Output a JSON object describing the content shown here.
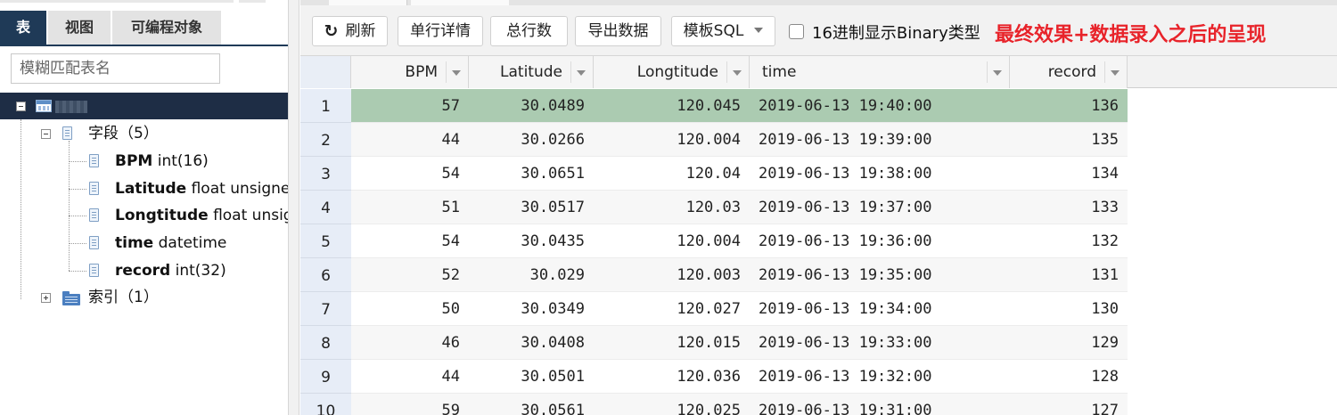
{
  "left_panel": {
    "tabs": [
      {
        "label": "表",
        "active": true
      },
      {
        "label": "视图",
        "active": false
      },
      {
        "label": "可编程对象",
        "active": false
      }
    ],
    "filter_placeholder": "模糊匹配表名",
    "tree": {
      "root_icon": "table-icon",
      "fields_group": {
        "label": "字段（5）",
        "icon": "document-icon"
      },
      "fields": [
        {
          "name": "BPM",
          "type": "int(16)"
        },
        {
          "name": "Latitude",
          "type": "float unsigned"
        },
        {
          "name": "Longtitude",
          "type": "float unsigned"
        },
        {
          "name": "time",
          "type": "datetime"
        },
        {
          "name": "record",
          "type": "int(32)"
        }
      ],
      "index_group": {
        "label": "索引（1）",
        "icon": "folder-index-icon"
      }
    }
  },
  "toolbar": {
    "refresh_icon": "refresh-icon",
    "refresh_label": "刷新",
    "row_detail_label": "单行详情",
    "total_rows_label": "总行数",
    "export_label": "导出数据",
    "template_sql_label": "模板SQL",
    "hex_checkbox_label": "16进制显示Binary类型",
    "hex_checked": false
  },
  "annotation": {
    "text": "最终效果+数据录入之后的呈现",
    "color": "#e8232a"
  },
  "grid": {
    "columns": [
      "BPM",
      "Latitude",
      "Longtitude",
      "time",
      "record"
    ],
    "selected_row": 1,
    "selected_color": "#abcbb1",
    "rows": [
      {
        "n": "1",
        "bpm": "57",
        "lat": "30.0489",
        "lng": "120.045",
        "time": "2019-06-13 19:40:00",
        "rec": "136"
      },
      {
        "n": "2",
        "bpm": "44",
        "lat": "30.0266",
        "lng": "120.004",
        "time": "2019-06-13 19:39:00",
        "rec": "135"
      },
      {
        "n": "3",
        "bpm": "54",
        "lat": "30.0651",
        "lng": "120.04",
        "time": "2019-06-13 19:38:00",
        "rec": "134"
      },
      {
        "n": "4",
        "bpm": "51",
        "lat": "30.0517",
        "lng": "120.03",
        "time": "2019-06-13 19:37:00",
        "rec": "133"
      },
      {
        "n": "5",
        "bpm": "54",
        "lat": "30.0435",
        "lng": "120.004",
        "time": "2019-06-13 19:36:00",
        "rec": "132"
      },
      {
        "n": "6",
        "bpm": "52",
        "lat": "30.029",
        "lng": "120.003",
        "time": "2019-06-13 19:35:00",
        "rec": "131"
      },
      {
        "n": "7",
        "bpm": "50",
        "lat": "30.0349",
        "lng": "120.027",
        "time": "2019-06-13 19:34:00",
        "rec": "130"
      },
      {
        "n": "8",
        "bpm": "46",
        "lat": "30.0408",
        "lng": "120.015",
        "time": "2019-06-13 19:33:00",
        "rec": "129"
      },
      {
        "n": "9",
        "bpm": "44",
        "lat": "30.0501",
        "lng": "120.036",
        "time": "2019-06-13 19:32:00",
        "rec": "128"
      },
      {
        "n": "10",
        "bpm": "59",
        "lat": "30.0561",
        "lng": "120.025",
        "time": "2019-06-13 19:31:00",
        "rec": "127"
      }
    ]
  }
}
